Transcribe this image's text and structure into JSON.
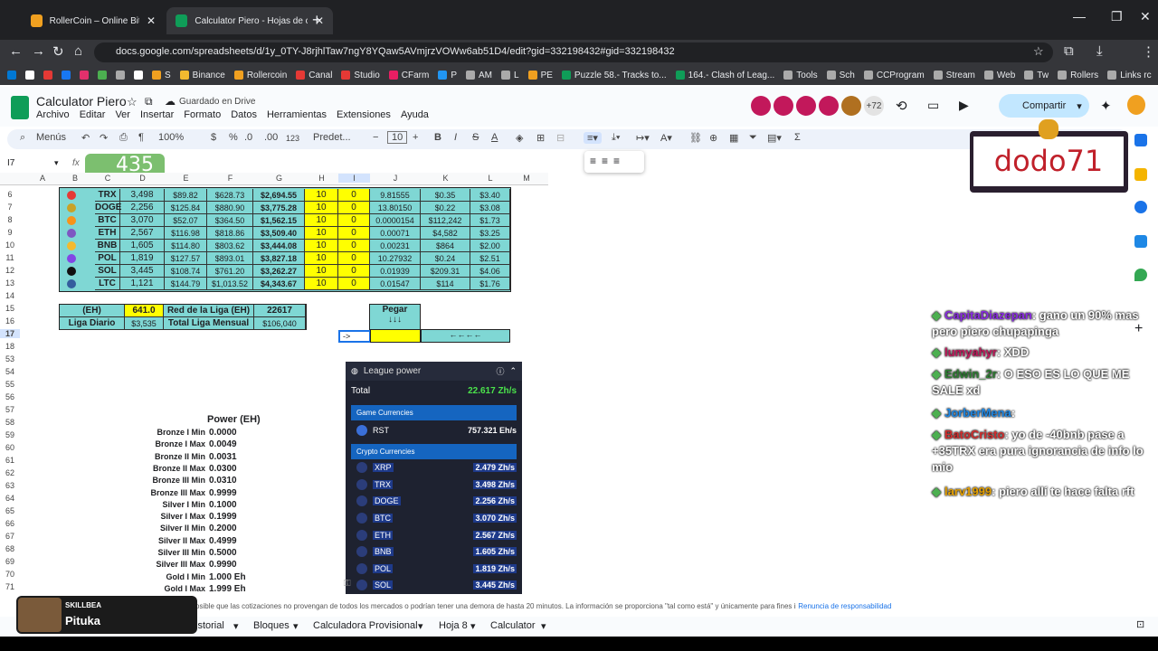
{
  "browser": {
    "tabs": [
      {
        "title": "RollerCoin – Online Bitcoin Mini",
        "active": false
      },
      {
        "title": "Calculator Piero - Hojas de cálc",
        "active": true
      }
    ],
    "url": "docs.google.com/spreadsheets/d/1y_0TY-J8rjhlTaw7ngY8YQaw5AVmjrzVOWw6ab51D4/edit?gid=332198432#gid=332198432",
    "bookmarks": [
      "S",
      "Binance",
      "Rollercoin",
      "Canal",
      "Studio",
      "CFarm",
      "P",
      "AM",
      "L",
      "PE",
      "Puzzle 58.- Tracks to...",
      "164.- Clash of Leag...",
      "Tools",
      "Sch",
      "CCProgram",
      "Stream",
      "Web",
      "Tw",
      "Rollers",
      "Links rc"
    ]
  },
  "doc": {
    "title": "Calculator Piero",
    "saved": "Guardado en Drive",
    "menus": [
      "Archivo",
      "Editar",
      "Ver",
      "Insertar",
      "Formato",
      "Datos",
      "Herramientas",
      "Extensiones",
      "Ayuda"
    ],
    "share": "Compartir",
    "avatar_count": "+72"
  },
  "toolbar": {
    "menus": "Menús",
    "zoom": "100%",
    "currency": "$",
    "percent": "%",
    "dec_less": ".0",
    "dec_more": ".00",
    "num_format": "123",
    "font": "Predet...",
    "font_size": "10"
  },
  "namebox": "I7",
  "overlay_number": "435",
  "columns": [
    "A",
    "B",
    "C",
    "D",
    "E",
    "F",
    "G",
    "H",
    "I",
    "J",
    "K",
    "L",
    "M"
  ],
  "row_numbers": [
    "6",
    "7",
    "8",
    "9",
    "10",
    "11",
    "12",
    "13",
    "14",
    "15",
    "16",
    "17",
    "18",
    "53",
    "54",
    "55",
    "56",
    "57",
    "58",
    "59",
    "60",
    "61",
    "62",
    "63",
    "64",
    "65",
    "66",
    "67",
    "68",
    "69",
    "70",
    "71",
    "72"
  ],
  "crypto_rows": [
    {
      "coin": "TRX",
      "c": "3,498",
      "d": "$89.82",
      "e": "$628.73",
      "f": "$2,694.55",
      "h": "10",
      "i": "0",
      "j": "9.81555",
      "k": "$0.35",
      "l": "$3.40",
      "color": "#e53935"
    },
    {
      "coin": "DOGE",
      "c": "2,256",
      "d": "$125.84",
      "e": "$880.90",
      "f": "$3,775.28",
      "h": "10",
      "i": "0",
      "j": "13.80150",
      "k": "$0.22",
      "l": "$3.08",
      "color": "#c9a227"
    },
    {
      "coin": "BTC",
      "c": "3,070",
      "d": "$52.07",
      "e": "$364.50",
      "f": "$1,562.15",
      "h": "10",
      "i": "0",
      "j": "0.0000154",
      "k": "$112,242",
      "l": "$1.73",
      "color": "#f7931a"
    },
    {
      "coin": "ETH",
      "c": "2,567",
      "d": "$116.98",
      "e": "$818.86",
      "f": "$3,509.40",
      "h": "10",
      "i": "0",
      "j": "0.00071",
      "k": "$4,582",
      "l": "$3.25",
      "color": "#7e57c2"
    },
    {
      "coin": "BNB",
      "c": "1,605",
      "d": "$114.80",
      "e": "$803.62",
      "f": "$3,444.08",
      "h": "10",
      "i": "0",
      "j": "0.00231",
      "k": "$864",
      "l": "$2.00",
      "color": "#f3ba2f"
    },
    {
      "coin": "POL",
      "c": "1,819",
      "d": "$127.57",
      "e": "$893.01",
      "f": "$3,827.18",
      "h": "10",
      "i": "0",
      "j": "10.27932",
      "k": "$0.24",
      "l": "$2.51",
      "color": "#8247e5"
    },
    {
      "coin": "SOL",
      "c": "3,445",
      "d": "$108.74",
      "e": "$761.20",
      "f": "$3,262.27",
      "h": "10",
      "i": "0",
      "j": "0.01939",
      "k": "$209.31",
      "l": "$4.06",
      "color": "#111111"
    },
    {
      "coin": "LTC",
      "c": "1,121",
      "d": "$144.79",
      "e": "$1,013.52",
      "f": "$4,343.67",
      "h": "10",
      "i": "0",
      "j": "0.01547",
      "k": "$114",
      "l": "$1.76",
      "color": "#345d9d"
    }
  ],
  "summary": {
    "eh_label": "(EH)",
    "eh_value": "641.0",
    "red_label": "Red de la Liga (EH)",
    "red_value": "22617",
    "daily_label": "Liga Diario",
    "daily_value": "$3,535",
    "monthly_label": "Total Liga Mensual",
    "monthly_value": "$106,040",
    "pegar": "Pegar",
    "arrows": "↓↓↓",
    "arrow_left": "←←←←",
    "cell_text": "->"
  },
  "power": {
    "header": "Power (EH)",
    "rows": [
      {
        "label": "Bronze I Min",
        "value": "0.0000"
      },
      {
        "label": "Bronze I Max",
        "value": "0.0049"
      },
      {
        "label": "Bronze II Min",
        "value": "0.0031"
      },
      {
        "label": "Bronze II Max",
        "value": "0.0300"
      },
      {
        "label": "Bronze III Min",
        "value": "0.0310"
      },
      {
        "label": "Bronze III Max",
        "value": "0.9999"
      },
      {
        "label": "Silver I Min",
        "value": "0.1000"
      },
      {
        "label": "Silver I Max",
        "value": "0.1999"
      },
      {
        "label": "Silver II Min",
        "value": "0.2000"
      },
      {
        "label": "Silver II Max",
        "value": "0.4999"
      },
      {
        "label": "Silver III Min",
        "value": "0.5000"
      },
      {
        "label": "Silver III Max",
        "value": "0.9990"
      },
      {
        "label": "Gold I Min",
        "value": "1.000 Eh"
      },
      {
        "label": "Gold I Max",
        "value": "1.999 Eh"
      }
    ]
  },
  "league": {
    "title": "League power",
    "total_label": "Total",
    "total_value": "22.617 Zh/s",
    "game_header": "Game Currencies",
    "game": [
      {
        "name": "RST",
        "value": "757.321 Eh/s"
      }
    ],
    "crypto_header": "Crypto Currencies",
    "crypto": [
      {
        "name": "XRP",
        "value": "2.479 Zh/s"
      },
      {
        "name": "TRX",
        "value": "3.498 Zh/s"
      },
      {
        "name": "DOGE",
        "value": "2.256 Zh/s"
      },
      {
        "name": "BTC",
        "value": "3.070 Zh/s"
      },
      {
        "name": "ETH",
        "value": "2.567 Zh/s"
      },
      {
        "name": "BNB",
        "value": "1.605 Zh/s"
      },
      {
        "name": "POL",
        "value": "1.819 Zh/s"
      },
      {
        "name": "SOL",
        "value": "3.445 Zh/s"
      }
    ]
  },
  "stream": {
    "name": "dodo71",
    "streamer": "Pituka",
    "brand": "SKILLBEA"
  },
  "chat": [
    {
      "user": "CapitaDiazepan",
      "text": ": gano un 90% mas pero piero chupapinga",
      "color": "#8a2be2"
    },
    {
      "user": "lumyahyr",
      "text": ": XDD",
      "color": "#c2185b"
    },
    {
      "user": "Edwin_2r",
      "text": ": O ESO ES LO QUE ME SALE xd",
      "color": "#2e7d32"
    },
    {
      "user": "JorberMena",
      "text": ":",
      "color": "#1e88e5"
    },
    {
      "user": "BatoCristo",
      "text": ": yo de -40bnb pase a +35TRX era pura ignorancia de info lo mio",
      "color": "#d32f2f"
    },
    {
      "user": "larv1999",
      "text": ": piero allí te hace falta rft",
      "color": "#e6a100"
    }
  ],
  "disclaimer": "Es posible que las cotizaciones no provengan de todos los mercados o podrían tener una demora de hasta 20 minutos. La información se proporciona \"tal como está\" y únicamente para fines informativos, pero no para comercialización ni asesoramiento.",
  "disclaimer_link": "Renuncia de responsabilidad",
  "sheet_tabs": [
    "istorial",
    "Bloques",
    "Calculadora Provisional",
    "Hoja 8",
    "Calculator"
  ]
}
